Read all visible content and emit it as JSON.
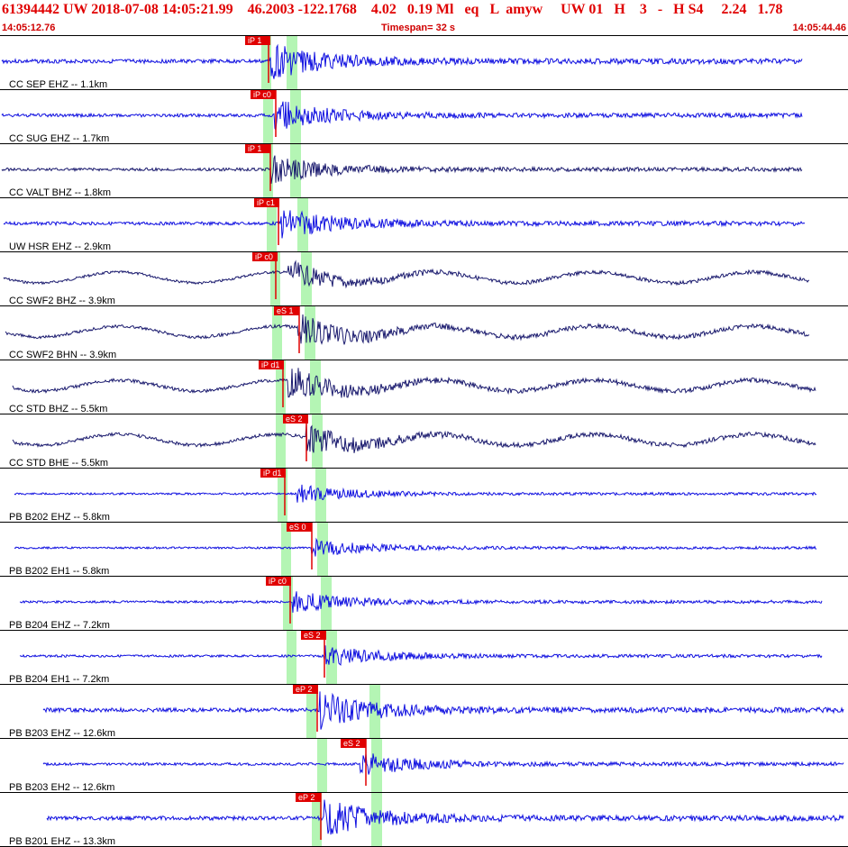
{
  "header": {
    "title": "61394442 UW 2018-07-08 14:05:21.99    46.2003 -122.1768    4.02   0.19 Ml   eq   L  amyw     UW 01   H    3   -   H S4     2.24   1.78",
    "start_time": "14:05:12.76",
    "timespan": "Timespan=  32 s",
    "end_time": "14:05:44.46"
  },
  "colors": {
    "trace_blue": "#1010e0",
    "trace_dark": "#1a1a6e",
    "pick_red": "#e00000",
    "window_green": "#b4f5b4",
    "text_red": "#d00000"
  },
  "traces": [
    {
      "label": "CC SEP EHZ -- 1.1km",
      "color": "blue",
      "pick1": "iP 1",
      "pick2": ""
    },
    {
      "label": "CC SUG EHZ -- 1.7km",
      "color": "blue",
      "pick1": "iP c0",
      "pick2": ""
    },
    {
      "label": "CC VALT BHZ -- 1.8km",
      "color": "dark",
      "pick1": "iP 1",
      "pick2": ""
    },
    {
      "label": "UW HSR EHZ -- 2.9km",
      "color": "blue",
      "pick1": "iP c1",
      "pick2": ""
    },
    {
      "label": "CC SWF2 BHZ -- 3.9km",
      "color": "dark",
      "pick1": "iP c0",
      "pick2": ""
    },
    {
      "label": "CC SWF2 BHN -- 3.9km",
      "color": "dark",
      "pick1": "eS 1",
      "pick2": ""
    },
    {
      "label": "CC STD BHZ -- 5.5km",
      "color": "dark",
      "pick1": "iP d1",
      "pick2": ""
    },
    {
      "label": "CC STD BHE -- 5.5km",
      "color": "dark",
      "pick1": "eS 2",
      "pick2": ""
    },
    {
      "label": "PB B202 EHZ -- 5.8km",
      "color": "blue",
      "pick1": "iP d1",
      "pick2": ""
    },
    {
      "label": "PB B202 EH1 -- 5.8km",
      "color": "blue",
      "pick1": "eS 0",
      "pick2": ""
    },
    {
      "label": "PB B204 EHZ -- 7.2km",
      "color": "blue",
      "pick1": "iP c0",
      "pick2": ""
    },
    {
      "label": "PB B204 EH1 -- 7.2km",
      "color": "blue",
      "pick1": "eS 2",
      "pick2": ""
    },
    {
      "label": "PB B203 EHZ -- 12.6km",
      "color": "blue",
      "pick1": "eP 2",
      "pick2": ""
    },
    {
      "label": "PB B203 EH2 -- 12.6km",
      "color": "blue",
      "pick1": "eS 2",
      "pick2": ""
    },
    {
      "label": "PB B201 EHZ -- 13.3km",
      "color": "blue",
      "pick1": "eP 2",
      "pick2": ""
    }
  ]
}
